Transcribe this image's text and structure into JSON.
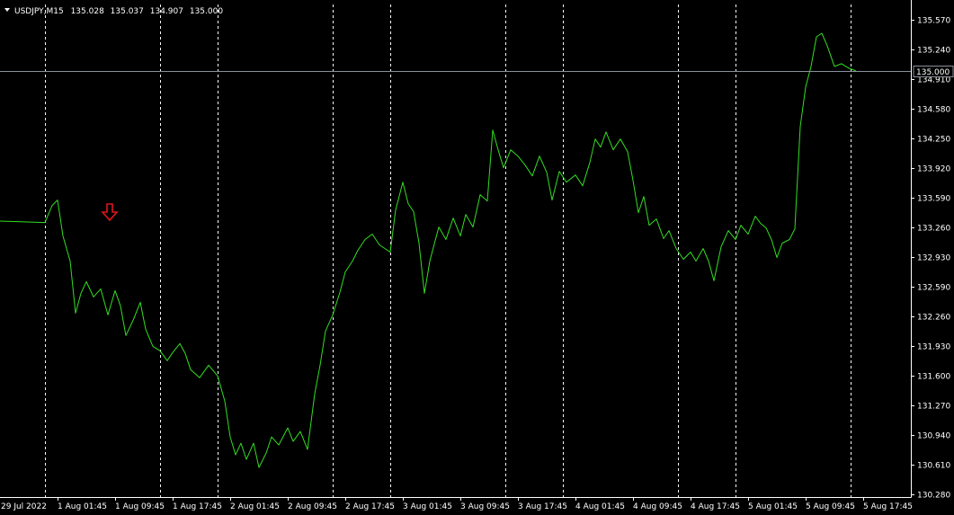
{
  "header": {
    "dropdown_icon": "triangle-down-icon",
    "symbol": "USDJPY,M15",
    "open": "135.028",
    "high": "135.037",
    "low": "134.907",
    "close": "135.000"
  },
  "colors": {
    "background": "#000000",
    "price_line": "#33dd22",
    "axis": "#ffffff",
    "grid": "#ffffff",
    "bid_line": "#8a8f9a",
    "marker": "#e0151a"
  },
  "marker": {
    "icon": "down-arrow-icon",
    "date": "1 Aug 2022",
    "time": "09:00"
  },
  "current_price_label": "135.000",
  "chart_data": {
    "type": "line",
    "title": "USDJPY,M15",
    "xlabel": "",
    "ylabel": "",
    "ylim": [
      130.218,
      135.755
    ],
    "y_ticks": [
      "135.570",
      "135.240",
      "134.910",
      "134.580",
      "134.250",
      "133.920",
      "133.590",
      "133.260",
      "132.930",
      "132.590",
      "132.260",
      "131.930",
      "131.600",
      "131.270",
      "130.940",
      "130.610",
      "130.280"
    ],
    "x_ticks": [
      "29 Jul 2022",
      "1 Aug 01:45",
      "1 Aug 09:45",
      "1 Aug 17:45",
      "2 Aug 01:45",
      "2 Aug 09:45",
      "2 Aug 17:45",
      "3 Aug 01:45",
      "3 Aug 09:45",
      "3 Aug 17:45",
      "4 Aug 01:45",
      "4 Aug 09:45",
      "4 Aug 17:45",
      "5 Aug 01:45",
      "5 Aug 09:45",
      "5 Aug 17:45"
    ],
    "day_separators": [
      "1 Aug 2022",
      "1 Aug 2022 16:00",
      "2 Aug 2022",
      "2 Aug 2022 16:00",
      "3 Aug 2022",
      "3 Aug 2022 16:00",
      "4 Aug 2022",
      "4 Aug 2022 16:00",
      "5 Aug 2022",
      "5 Aug 2022 16:00"
    ],
    "current_price": 135.0,
    "series": [
      {
        "name": "USDJPY,M15",
        "points": [
          [
            "29 Jul 21:00",
            133.66
          ],
          [
            "29 Jul 22:45",
            133.44
          ],
          [
            "1 Aug 00:00",
            133.31
          ],
          [
            "1 Aug 01:00",
            133.5
          ],
          [
            "1 Aug 01:45",
            133.56
          ],
          [
            "1 Aug 02:30",
            133.16
          ],
          [
            "1 Aug 03:30",
            132.88
          ],
          [
            "1 Aug 04:15",
            132.3
          ],
          [
            "1 Aug 05:00",
            132.52
          ],
          [
            "1 Aug 05:45",
            132.65
          ],
          [
            "1 Aug 06:45",
            132.48
          ],
          [
            "1 Aug 07:45",
            132.57
          ],
          [
            "1 Aug 08:45",
            132.28
          ],
          [
            "1 Aug 09:45",
            132.55
          ],
          [
            "1 Aug 10:30",
            132.38
          ],
          [
            "1 Aug 11:15",
            132.05
          ],
          [
            "1 Aug 12:15",
            132.22
          ],
          [
            "1 Aug 13:15",
            132.42
          ],
          [
            "1 Aug 14:00",
            132.12
          ],
          [
            "1 Aug 15:00",
            131.93
          ],
          [
            "1 Aug 16:00",
            131.88
          ],
          [
            "1 Aug 17:00",
            131.77
          ],
          [
            "1 Aug 17:45",
            131.86
          ],
          [
            "1 Aug 18:45",
            131.96
          ],
          [
            "1 Aug 19:30",
            131.85
          ],
          [
            "1 Aug 20:15",
            131.67
          ],
          [
            "1 Aug 21:30",
            131.58
          ],
          [
            "1 Aug 22:45",
            131.72
          ],
          [
            "2 Aug 00:00",
            131.6
          ],
          [
            "2 Aug 01:00",
            131.32
          ],
          [
            "2 Aug 01:45",
            130.92
          ],
          [
            "2 Aug 02:30",
            130.72
          ],
          [
            "2 Aug 03:15",
            130.85
          ],
          [
            "2 Aug 04:00",
            130.67
          ],
          [
            "2 Aug 05:00",
            130.85
          ],
          [
            "2 Aug 05:45",
            130.58
          ],
          [
            "2 Aug 06:45",
            130.74
          ],
          [
            "2 Aug 07:30",
            130.92
          ],
          [
            "2 Aug 08:30",
            130.83
          ],
          [
            "2 Aug 09:45",
            131.02
          ],
          [
            "2 Aug 10:30",
            130.87
          ],
          [
            "2 Aug 11:30",
            130.98
          ],
          [
            "2 Aug 12:30",
            130.78
          ],
          [
            "2 Aug 13:30",
            131.4
          ],
          [
            "2 Aug 14:15",
            131.72
          ],
          [
            "2 Aug 15:00",
            132.1
          ],
          [
            "2 Aug 16:00",
            132.28
          ],
          [
            "2 Aug 17:00",
            132.53
          ],
          [
            "2 Aug 17:45",
            132.76
          ],
          [
            "2 Aug 18:45",
            132.88
          ],
          [
            "2 Aug 19:30",
            133.0
          ],
          [
            "2 Aug 20:30",
            133.12
          ],
          [
            "2 Aug 21:30",
            133.18
          ],
          [
            "2 Aug 22:30",
            133.06
          ],
          [
            "3 Aug 00:00",
            132.98
          ],
          [
            "3 Aug 00:45",
            133.45
          ],
          [
            "3 Aug 01:45",
            133.76
          ],
          [
            "3 Aug 02:30",
            133.52
          ],
          [
            "3 Aug 03:15",
            133.43
          ],
          [
            "3 Aug 04:00",
            133.08
          ],
          [
            "3 Aug 04:45",
            132.52
          ],
          [
            "3 Aug 05:30",
            132.88
          ],
          [
            "3 Aug 06:45",
            133.26
          ],
          [
            "3 Aug 07:45",
            133.12
          ],
          [
            "3 Aug 08:45",
            133.36
          ],
          [
            "3 Aug 09:45",
            133.16
          ],
          [
            "3 Aug 10:30",
            133.4
          ],
          [
            "3 Aug 11:30",
            133.26
          ],
          [
            "3 Aug 12:30",
            133.62
          ],
          [
            "3 Aug 13:30",
            133.55
          ],
          [
            "3 Aug 14:15",
            134.34
          ],
          [
            "3 Aug 15:00",
            134.12
          ],
          [
            "3 Aug 15:45",
            133.92
          ],
          [
            "3 Aug 16:45",
            134.12
          ],
          [
            "3 Aug 17:45",
            134.05
          ],
          [
            "3 Aug 18:45",
            133.95
          ],
          [
            "3 Aug 19:45",
            133.83
          ],
          [
            "3 Aug 20:45",
            134.05
          ],
          [
            "3 Aug 21:45",
            133.87
          ],
          [
            "3 Aug 22:30",
            133.56
          ],
          [
            "3 Aug 23:30",
            133.88
          ],
          [
            "4 Aug 00:30",
            133.76
          ],
          [
            "4 Aug 01:45",
            133.84
          ],
          [
            "4 Aug 02:45",
            133.72
          ],
          [
            "4 Aug 03:45",
            133.98
          ],
          [
            "4 Aug 04:30",
            134.24
          ],
          [
            "4 Aug 05:15",
            134.15
          ],
          [
            "4 Aug 06:00",
            134.32
          ],
          [
            "4 Aug 07:00",
            134.12
          ],
          [
            "4 Aug 08:00",
            134.24
          ],
          [
            "4 Aug 09:00",
            134.1
          ],
          [
            "4 Aug 09:45",
            133.78
          ],
          [
            "4 Aug 10:30",
            133.42
          ],
          [
            "4 Aug 11:15",
            133.6
          ],
          [
            "4 Aug 12:00",
            133.28
          ],
          [
            "4 Aug 13:00",
            133.35
          ],
          [
            "4 Aug 14:00",
            133.13
          ],
          [
            "4 Aug 14:45",
            133.22
          ],
          [
            "4 Aug 15:45",
            133.02
          ],
          [
            "4 Aug 16:45",
            132.9
          ],
          [
            "4 Aug 17:45",
            132.98
          ],
          [
            "4 Aug 18:30",
            132.88
          ],
          [
            "4 Aug 19:30",
            133.02
          ],
          [
            "4 Aug 20:15",
            132.88
          ],
          [
            "4 Aug 21:00",
            132.66
          ],
          [
            "4 Aug 22:00",
            133.04
          ],
          [
            "4 Aug 23:00",
            133.22
          ],
          [
            "5 Aug 00:00",
            133.12
          ],
          [
            "5 Aug 00:45",
            133.28
          ],
          [
            "5 Aug 01:45",
            133.18
          ],
          [
            "5 Aug 02:45",
            133.38
          ],
          [
            "5 Aug 03:30",
            133.3
          ],
          [
            "5 Aug 04:15",
            133.25
          ],
          [
            "5 Aug 05:00",
            133.12
          ],
          [
            "5 Aug 05:45",
            132.92
          ],
          [
            "5 Aug 06:30",
            133.08
          ],
          [
            "5 Aug 07:30",
            133.12
          ],
          [
            "5 Aug 08:15",
            133.24
          ],
          [
            "5 Aug 09:00",
            134.38
          ],
          [
            "5 Aug 09:45",
            134.82
          ],
          [
            "5 Aug 10:30",
            135.05
          ],
          [
            "5 Aug 11:15",
            135.38
          ],
          [
            "5 Aug 12:00",
            135.42
          ],
          [
            "5 Aug 12:45",
            135.28
          ],
          [
            "5 Aug 13:45",
            135.05
          ],
          [
            "5 Aug 14:45",
            135.08
          ],
          [
            "5 Aug 15:45",
            135.03
          ],
          [
            "5 Aug 16:45",
            135.0
          ]
        ]
      }
    ]
  }
}
